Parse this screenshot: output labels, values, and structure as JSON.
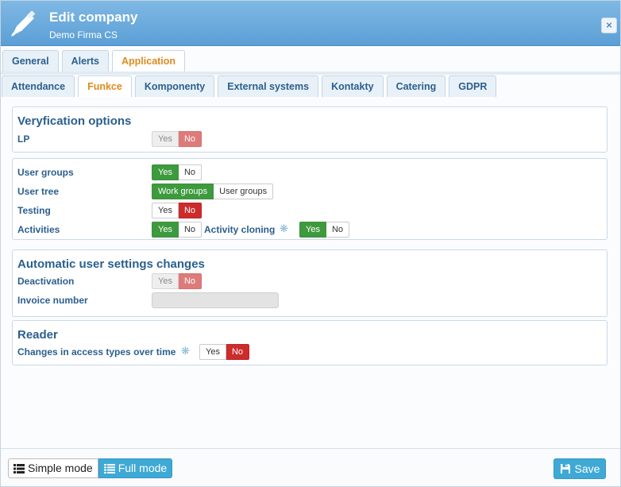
{
  "header": {
    "title": "Edit company",
    "subtitle": "Demo Firma CS",
    "close_label": "×"
  },
  "tabs": [
    {
      "label": "General"
    },
    {
      "label": "Alerts"
    },
    {
      "label": "Application",
      "active": true
    }
  ],
  "subtabs": [
    {
      "label": "Attendance"
    },
    {
      "label": "Funkce",
      "active": true
    },
    {
      "label": "Komponenty"
    },
    {
      "label": "External systems"
    },
    {
      "label": "Kontakty"
    },
    {
      "label": "Catering"
    },
    {
      "label": "GDPR"
    }
  ],
  "verification": {
    "title": "Veryfication options",
    "lp_label": "LP",
    "lp_yes": "Yes",
    "lp_no": "No"
  },
  "groups": {
    "user_groups_label": "User groups",
    "user_groups_yes": "Yes",
    "user_groups_no": "No",
    "user_tree_label": "User tree",
    "user_tree_opt1": "Work groups",
    "user_tree_opt2": "User groups",
    "testing_label": "Testing",
    "testing_yes": "Yes",
    "testing_no": "No",
    "activities_label": "Activities",
    "activities_yes": "Yes",
    "activities_no": "No",
    "cloning_label": "Activity cloning",
    "cloning_yes": "Yes",
    "cloning_no": "No",
    "asterisk": "❋"
  },
  "automatic": {
    "title": "Automatic user settings changes",
    "deactivation_label": "Deactivation",
    "deactivation_yes": "Yes",
    "deactivation_no": "No",
    "invoice_label": "Invoice number"
  },
  "reader": {
    "title": "Reader",
    "access_label": "Changes in access types over time",
    "access_yes": "Yes",
    "access_no": "No",
    "asterisk": "❋"
  },
  "footer": {
    "simple_mode": "Simple mode",
    "full_mode": "Full mode",
    "save": "Save"
  },
  "colors": {
    "header_blue": "#5b9fd6",
    "tab_active_orange": "#e08a1e",
    "toggle_green": "#3d9a3d",
    "toggle_red": "#cc2c2c",
    "button_blue": "#3fa9d6"
  }
}
